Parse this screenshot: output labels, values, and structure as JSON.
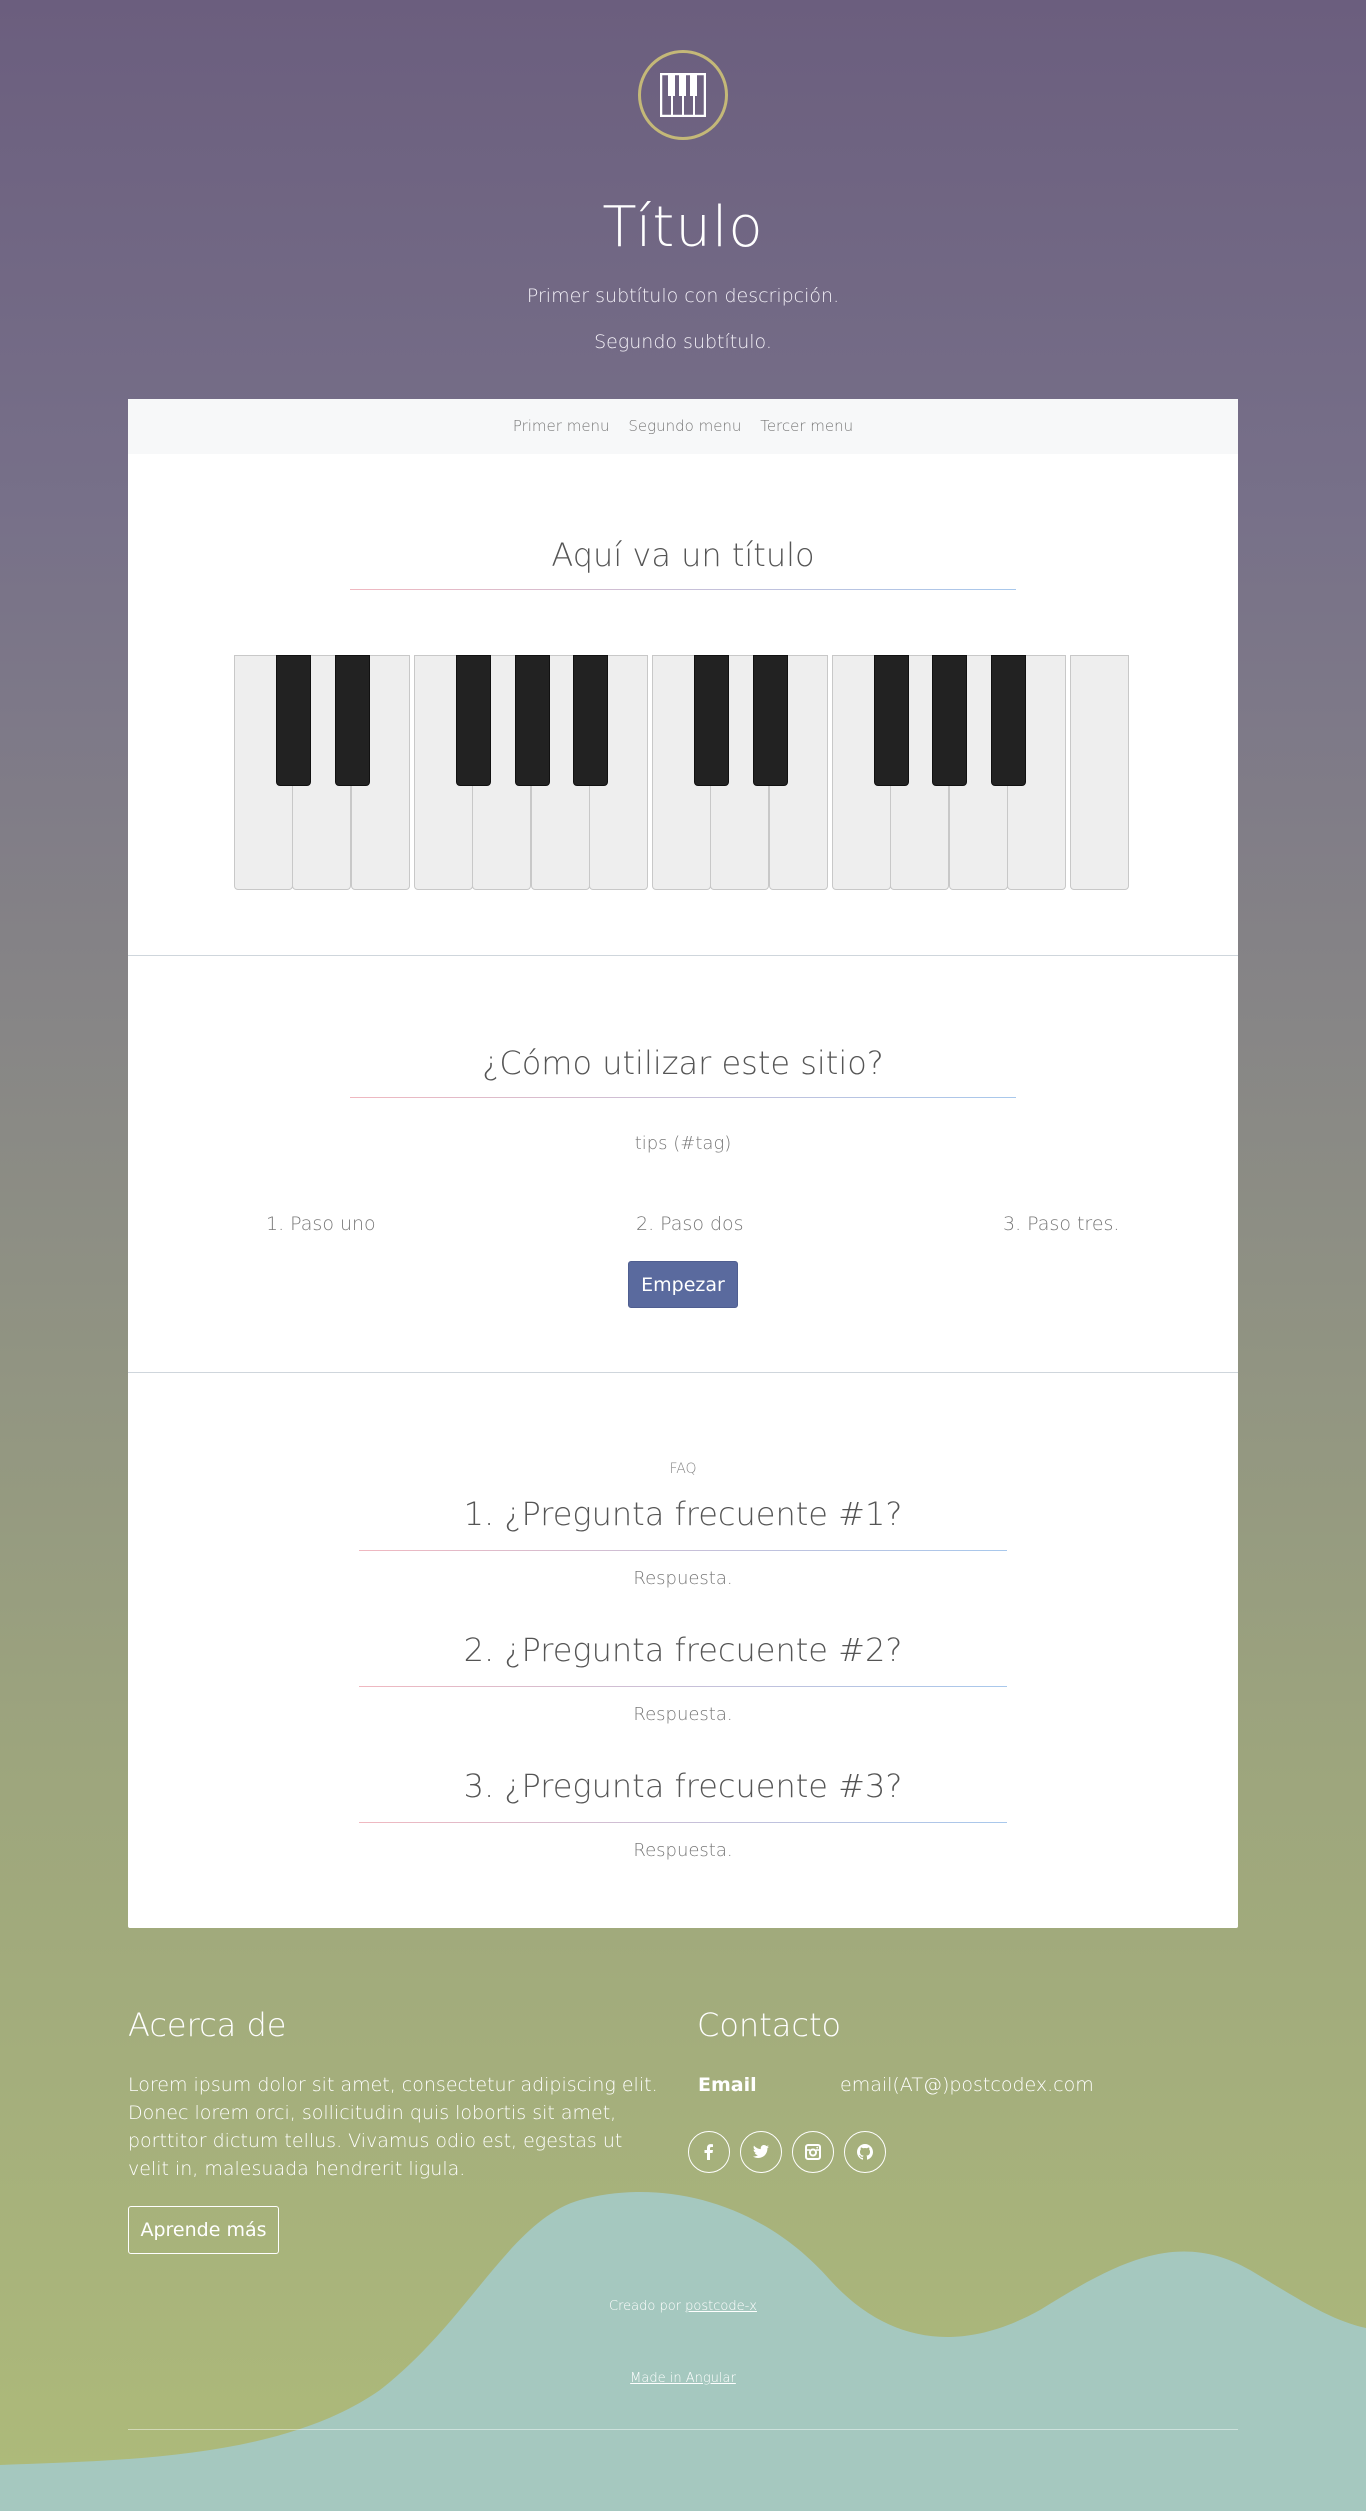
{
  "hero": {
    "title": "Título",
    "subtitle1": "Primer subtítulo con descripción.",
    "subtitle2": "Segundo subtítulo."
  },
  "nav": {
    "items": [
      "Primer menu",
      "Segundo menu",
      "Tercer menu"
    ]
  },
  "piano_section": {
    "title": "Aquí va un título",
    "white_keys": 15,
    "black_keys": 10
  },
  "howto": {
    "title": "¿Cómo utilizar este sitio?",
    "tips": "tips (#tag)",
    "steps": [
      "1. Paso uno",
      "2. Paso dos",
      "3. Paso tres."
    ],
    "start_label": "Empezar"
  },
  "faq": {
    "label": "FAQ",
    "items": [
      {
        "q": "1. ¿Pregunta frecuente #1?",
        "a": "Respuesta."
      },
      {
        "q": "2. ¿Pregunta frecuente #2?",
        "a": "Respuesta."
      },
      {
        "q": "3. ¿Pregunta frecuente #3?",
        "a": "Respuesta."
      }
    ]
  },
  "footer": {
    "about_title": "Acerca de",
    "about_text": "Lorem ipsum dolor sit amet, consectetur adipiscing elit. Donec lorem orci, sollicitudin quis lobortis sit amet, porttitor dictum tellus. Vivamus odio est, egestas ut velit in, malesuada hendrerit ligula.",
    "learn_more": "Aprende más",
    "contact_title": "Contacto",
    "email_label": "Email",
    "email_value": "email(AT@)postcodex.com",
    "social_icons": [
      "facebook-icon",
      "twitter-icon",
      "instagram-icon",
      "github-icon"
    ],
    "credit_prefix": "Creado por",
    "credit_link": "postcode-x",
    "made_in": "Made in Angular"
  },
  "colors": {
    "accent": "#5a6a9e",
    "wave": "#a5c8bf",
    "logo_ring": "#c4b878"
  }
}
